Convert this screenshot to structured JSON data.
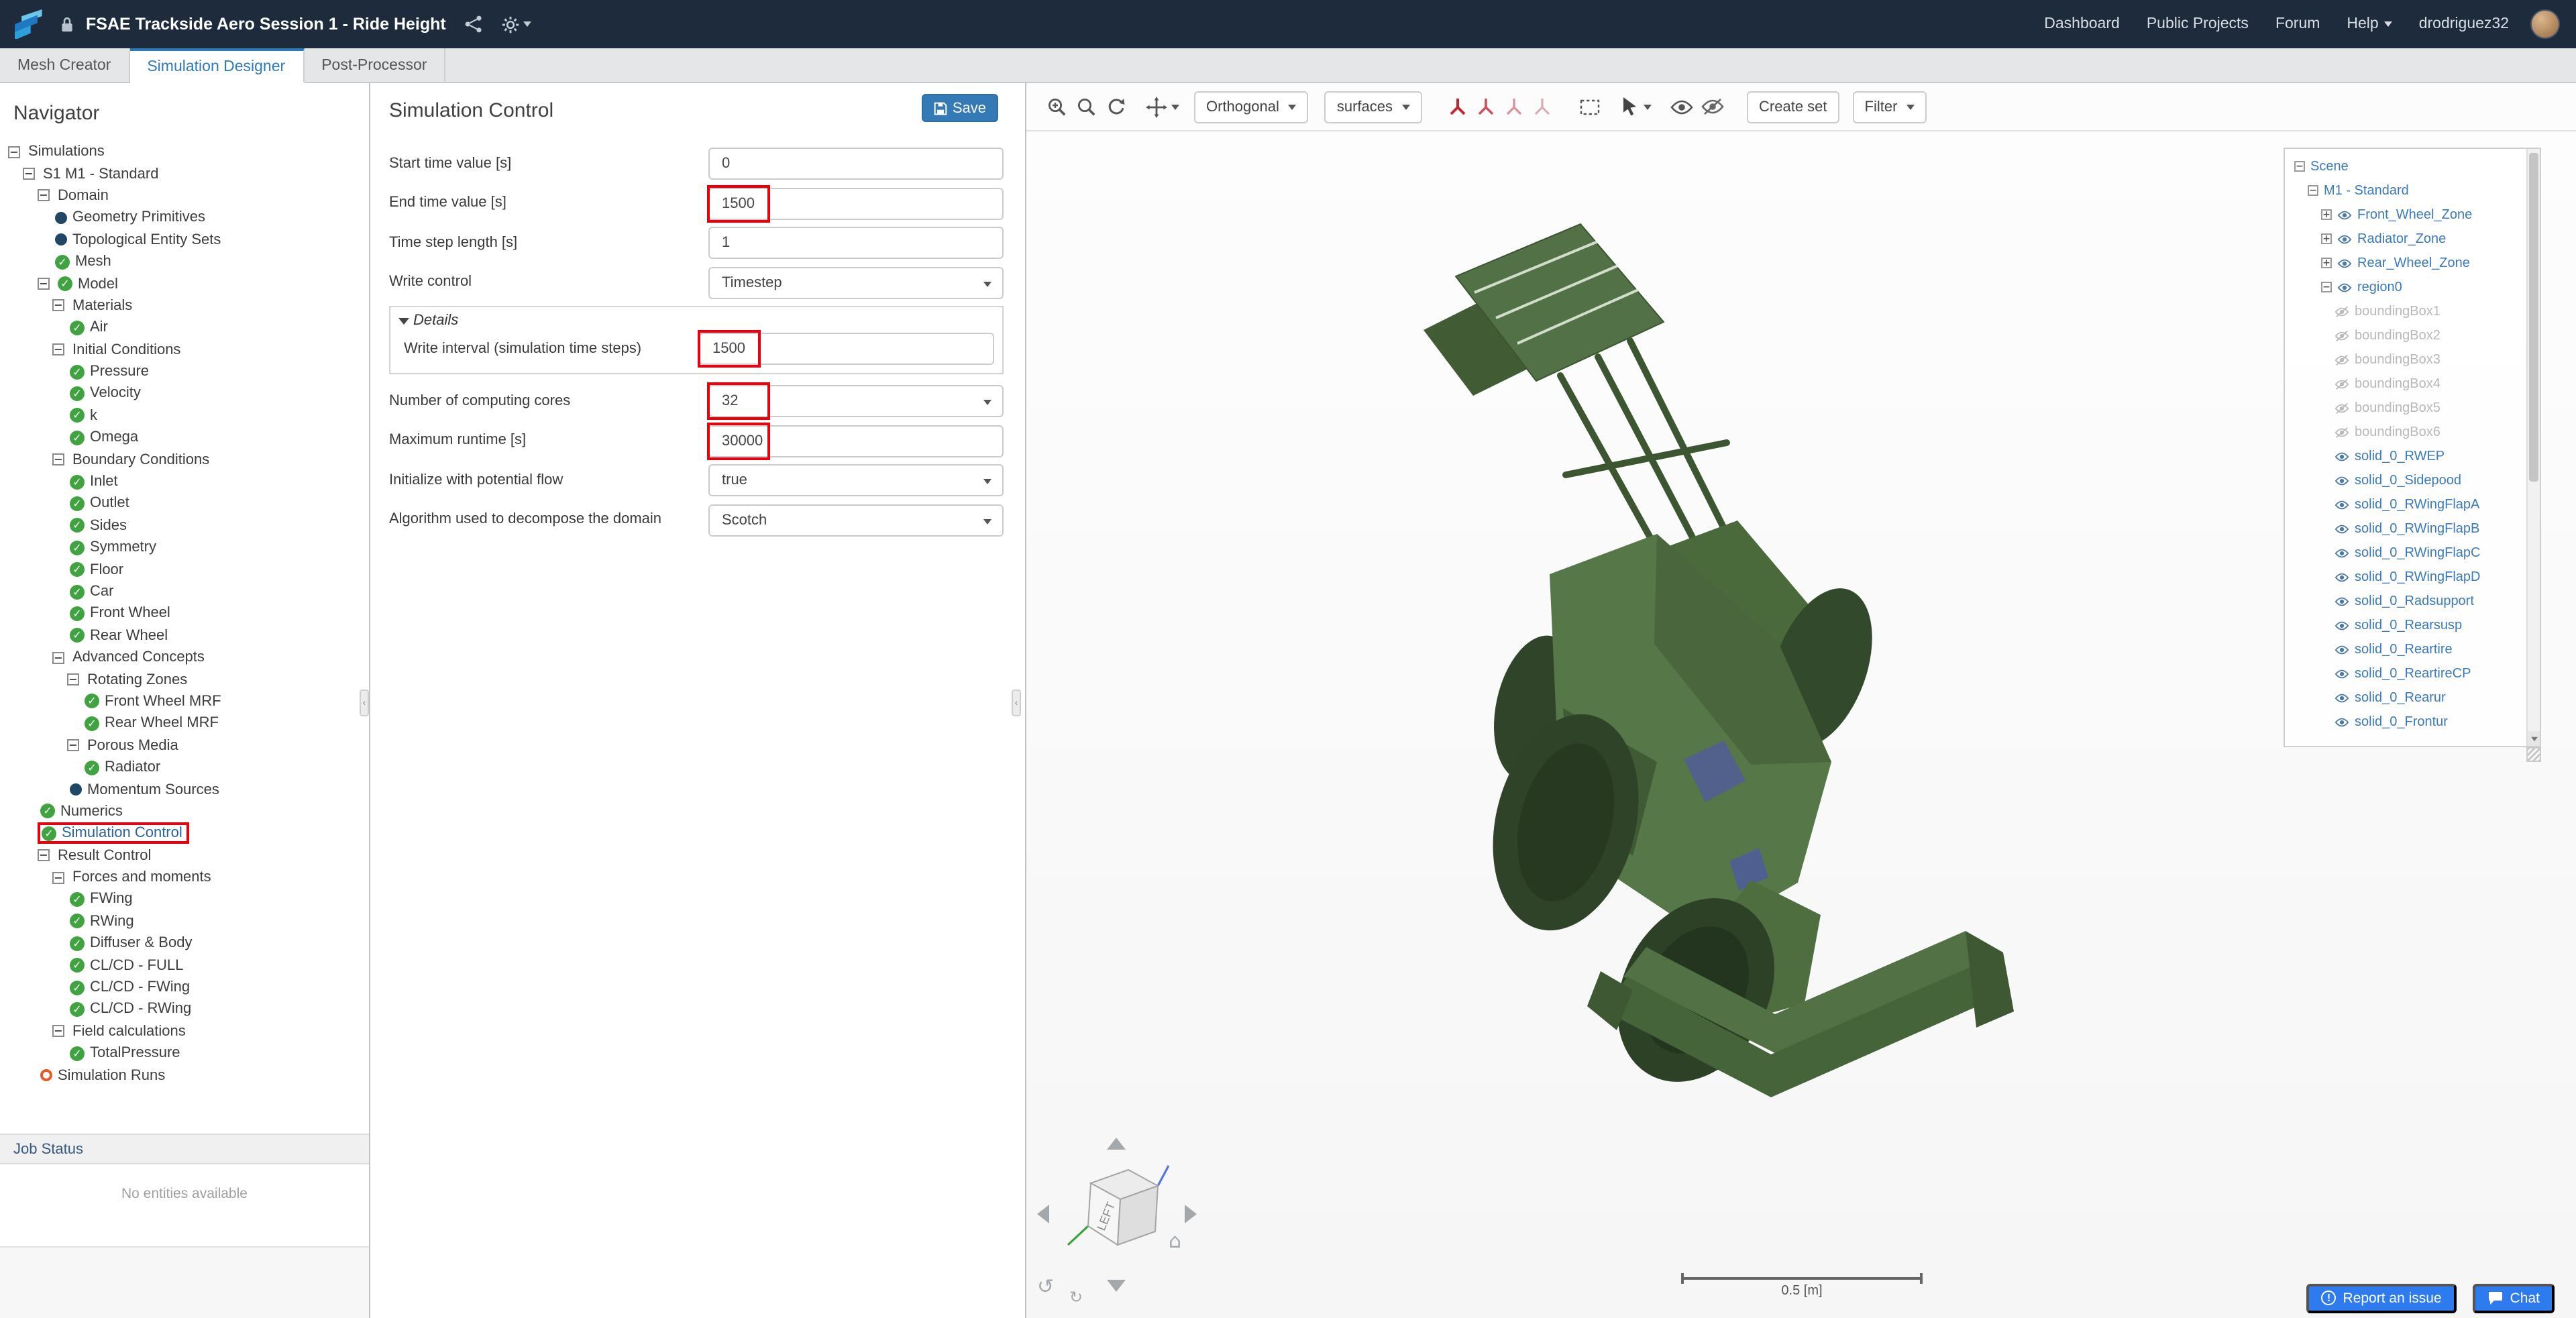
{
  "colors": {
    "topbar_bg": "#1d2b3d",
    "accent_blue": "#337ab7",
    "tab_active_blue": "#2e79b8",
    "annotation_red": "#e8000d",
    "check_green": "#3fa43f",
    "warning_ring_orange": "#e05c2a",
    "car_green": "#527147",
    "action_button_blue": "#2d7bef"
  },
  "topbar": {
    "title": "FSAE Trackside Aero Session 1 - Ride Height",
    "nav": [
      "Dashboard",
      "Public Projects",
      "Forum",
      "Help"
    ],
    "username": "drodriguez32"
  },
  "tabs": [
    {
      "label": "Mesh Creator",
      "active": false
    },
    {
      "label": "Simulation Designer",
      "active": true
    },
    {
      "label": "Post-Processor",
      "active": false
    }
  ],
  "navigator": {
    "title": "Navigator",
    "job_status_title": "Job Status",
    "job_status_empty": "No entities available",
    "tree": [
      {
        "label": "Simulations",
        "level": 0,
        "expander": "minus",
        "icon": null
      },
      {
        "label": "S1 M1 - Standard",
        "level": 1,
        "expander": "minus",
        "icon": null
      },
      {
        "label": "Domain",
        "level": 2,
        "expander": "minus",
        "icon": null
      },
      {
        "label": "Geometry Primitives",
        "level": 3,
        "expander": null,
        "icon": "dot"
      },
      {
        "label": "Topological Entity Sets",
        "level": 3,
        "expander": null,
        "icon": "dot"
      },
      {
        "label": "Mesh",
        "level": 3,
        "expander": null,
        "icon": "check"
      },
      {
        "label": "Model",
        "level": 2,
        "expander": "minus",
        "icon": "check"
      },
      {
        "label": "Materials",
        "level": 3,
        "expander": "minus",
        "icon": null
      },
      {
        "label": "Air",
        "level": 4,
        "expander": null,
        "icon": "check"
      },
      {
        "label": "Initial Conditions",
        "level": 3,
        "expander": "minus",
        "icon": null
      },
      {
        "label": "Pressure",
        "level": 4,
        "expander": null,
        "icon": "check"
      },
      {
        "label": "Velocity",
        "level": 4,
        "expander": null,
        "icon": "check"
      },
      {
        "label": "k",
        "level": 4,
        "expander": null,
        "icon": "check"
      },
      {
        "label": "Omega",
        "level": 4,
        "expander": null,
        "icon": "check"
      },
      {
        "label": "Boundary Conditions",
        "level": 3,
        "expander": "minus",
        "icon": null
      },
      {
        "label": "Inlet",
        "level": 4,
        "expander": null,
        "icon": "check"
      },
      {
        "label": "Outlet",
        "level": 4,
        "expander": null,
        "icon": "check"
      },
      {
        "label": "Sides",
        "level": 4,
        "expander": null,
        "icon": "check"
      },
      {
        "label": "Symmetry",
        "level": 4,
        "expander": null,
        "icon": "check"
      },
      {
        "label": "Floor",
        "level": 4,
        "expander": null,
        "icon": "check"
      },
      {
        "label": "Car",
        "level": 4,
        "expander": null,
        "icon": "check"
      },
      {
        "label": "Front Wheel",
        "level": 4,
        "expander": null,
        "icon": "check"
      },
      {
        "label": "Rear Wheel",
        "level": 4,
        "expander": null,
        "icon": "check"
      },
      {
        "label": "Advanced Concepts",
        "level": 3,
        "expander": "minus",
        "icon": null
      },
      {
        "label": "Rotating Zones",
        "level": 4,
        "expander": "minus",
        "icon": null
      },
      {
        "label": "Front Wheel MRF",
        "level": 5,
        "expander": null,
        "icon": "check"
      },
      {
        "label": "Rear Wheel MRF",
        "level": 5,
        "expander": null,
        "icon": "check"
      },
      {
        "label": "Porous Media",
        "level": 4,
        "expander": "minus",
        "icon": null
      },
      {
        "label": "Radiator",
        "level": 5,
        "expander": null,
        "icon": "check"
      },
      {
        "label": "Momentum Sources",
        "level": 4,
        "expander": null,
        "icon": "dot"
      },
      {
        "label": "Numerics",
        "level": 2,
        "expander": null,
        "icon": "check"
      },
      {
        "label": "Simulation Control",
        "level": 2,
        "expander": null,
        "icon": "check",
        "selected": true
      },
      {
        "label": "Result Control",
        "level": 2,
        "expander": "minus",
        "icon": null
      },
      {
        "label": "Forces and moments",
        "level": 3,
        "expander": "minus",
        "icon": null
      },
      {
        "label": "FWing",
        "level": 4,
        "expander": null,
        "icon": "check"
      },
      {
        "label": "RWing",
        "level": 4,
        "expander": null,
        "icon": "check"
      },
      {
        "label": "Diffuser & Body",
        "level": 4,
        "expander": null,
        "icon": "check"
      },
      {
        "label": "CL/CD - FULL",
        "level": 4,
        "expander": null,
        "icon": "check"
      },
      {
        "label": "CL/CD - FWing",
        "level": 4,
        "expander": null,
        "icon": "check"
      },
      {
        "label": "CL/CD - RWing",
        "level": 4,
        "expander": null,
        "icon": "check"
      },
      {
        "label": "Field calculations",
        "level": 3,
        "expander": "minus",
        "icon": null
      },
      {
        "label": "TotalPressure",
        "level": 4,
        "expander": null,
        "icon": "check"
      },
      {
        "label": "Simulation Runs",
        "level": 2,
        "expander": null,
        "icon": "ring"
      }
    ]
  },
  "panel": {
    "title": "Simulation Control",
    "save_label": "Save",
    "rows_top": [
      {
        "label": "Start time value [s]",
        "value": "0",
        "type": "input",
        "highlight": false
      },
      {
        "label": "End time value [s]",
        "value": "1500",
        "type": "input",
        "highlight": true
      },
      {
        "label": "Time step length [s]",
        "value": "1",
        "type": "input",
        "highlight": false
      },
      {
        "label": "Write control",
        "value": "Timestep",
        "type": "select",
        "highlight": false
      }
    ],
    "details_label": "Details",
    "details_rows": [
      {
        "label": "Write interval (simulation time steps)",
        "value": "1500",
        "type": "input",
        "highlight": true
      }
    ],
    "rows_bottom": [
      {
        "label": "Number of computing cores",
        "value": "32",
        "type": "select",
        "highlight": true
      },
      {
        "label": "Maximum runtime [s]",
        "value": "30000",
        "type": "input",
        "highlight": true
      },
      {
        "label": "Initialize with potential flow",
        "value": "true",
        "type": "select",
        "highlight": false
      },
      {
        "label": "Algorithm used to decompose the domain",
        "value": "Scotch",
        "type": "select",
        "highlight": false
      }
    ]
  },
  "viewport": {
    "orthogonal_label": "Orthogonal",
    "surfaces_label": "surfaces",
    "create_set_label": "Create set",
    "filter_label": "Filter",
    "scale_label": "0.5 [m]",
    "cube_face_label": "LEFT",
    "report_issue_label": "Report an issue",
    "chat_label": "Chat",
    "scene_tree": [
      {
        "label": "Scene",
        "level": 0,
        "expander": "minus",
        "icon": null,
        "muted": false
      },
      {
        "label": "M1 - Standard",
        "level": 1,
        "expander": "minus",
        "icon": null,
        "muted": false
      },
      {
        "label": "Front_Wheel_Zone",
        "level": 2,
        "expander": "plus",
        "icon": "eye",
        "muted": false
      },
      {
        "label": "Radiator_Zone",
        "level": 2,
        "expander": "plus",
        "icon": "eye",
        "muted": false
      },
      {
        "label": "Rear_Wheel_Zone",
        "level": 2,
        "expander": "plus",
        "icon": "eye",
        "muted": false
      },
      {
        "label": "region0",
        "level": 2,
        "expander": "minus",
        "icon": "eye",
        "muted": false
      },
      {
        "label": "boundingBox1",
        "level": 3,
        "expander": null,
        "icon": "eye-off",
        "muted": true
      },
      {
        "label": "boundingBox2",
        "level": 3,
        "expander": null,
        "icon": "eye-off",
        "muted": true
      },
      {
        "label": "boundingBox3",
        "level": 3,
        "expander": null,
        "icon": "eye-off",
        "muted": true
      },
      {
        "label": "boundingBox4",
        "level": 3,
        "expander": null,
        "icon": "eye-off",
        "muted": true
      },
      {
        "label": "boundingBox5",
        "level": 3,
        "expander": null,
        "icon": "eye-off",
        "muted": true
      },
      {
        "label": "boundingBox6",
        "level": 3,
        "expander": null,
        "icon": "eye-off",
        "muted": true
      },
      {
        "label": "solid_0_RWEP",
        "level": 3,
        "expander": null,
        "icon": "eye",
        "muted": false
      },
      {
        "label": "solid_0_Sidepood",
        "level": 3,
        "expander": null,
        "icon": "eye",
        "muted": false
      },
      {
        "label": "solid_0_RWingFlapA",
        "level": 3,
        "expander": null,
        "icon": "eye",
        "muted": false
      },
      {
        "label": "solid_0_RWingFlapB",
        "level": 3,
        "expander": null,
        "icon": "eye",
        "muted": false
      },
      {
        "label": "solid_0_RWingFlapC",
        "level": 3,
        "expander": null,
        "icon": "eye",
        "muted": false
      },
      {
        "label": "solid_0_RWingFlapD",
        "level": 3,
        "expander": null,
        "icon": "eye",
        "muted": false
      },
      {
        "label": "solid_0_Radsupport",
        "level": 3,
        "expander": null,
        "icon": "eye",
        "muted": false
      },
      {
        "label": "solid_0_Rearsusp",
        "level": 3,
        "expander": null,
        "icon": "eye",
        "muted": false
      },
      {
        "label": "solid_0_Reartire",
        "level": 3,
        "expander": null,
        "icon": "eye",
        "muted": false
      },
      {
        "label": "solid_0_ReartireCP",
        "level": 3,
        "expander": null,
        "icon": "eye",
        "muted": false
      },
      {
        "label": "solid_0_Rearur",
        "level": 3,
        "expander": null,
        "icon": "eye",
        "muted": false
      },
      {
        "label": "solid_0_Frontur",
        "level": 3,
        "expander": null,
        "icon": "eye",
        "muted": false
      }
    ]
  }
}
